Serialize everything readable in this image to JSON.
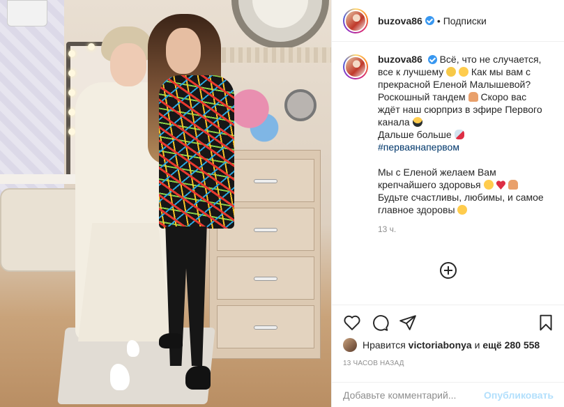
{
  "post": {
    "author": "buzova86",
    "separator": "•",
    "follow_label": "Подписки"
  },
  "caption": {
    "username": "buzova86",
    "line1": "Всё, что не случается,",
    "line2": "все к лучшему",
    "line2b": "Как мы вам с",
    "line3": "прекрасной Еленой Малышевой?",
    "line4a": "Роскошный тандем",
    "line4b": "Скоро вас",
    "line5": "ждёт наш сюрприз в эфире Первого",
    "line6": "канала",
    "line7": "Дальше больше",
    "hashtag": "#перваянапервом",
    "line8": "Мы с Еленой желаем Вам",
    "line9": "крепчайшего здоровья",
    "line10": "Будьте счастливы, любимы, и самое",
    "line11": "главное здоровы",
    "time": "13 ч."
  },
  "likes": {
    "prefix": "Нравится",
    "user": "victoriabonya",
    "mid": "и",
    "count": "ещё 280 558"
  },
  "posted_ago": "13 ЧАСОВ НАЗАД",
  "comment_box": {
    "placeholder": "Добавьте комментарий...",
    "publish_label": "Опубликовать"
  },
  "icons": {
    "like": "heart-icon",
    "comment": "comment-icon",
    "share": "share-icon",
    "save": "bookmark-icon",
    "more": "plus-circle-icon",
    "verified": "verified-badge-icon"
  },
  "colors": {
    "link": "#00376b",
    "verified": "#3897f0",
    "publish_disabled": "#b2dffc",
    "muted": "#8e8e8e"
  }
}
